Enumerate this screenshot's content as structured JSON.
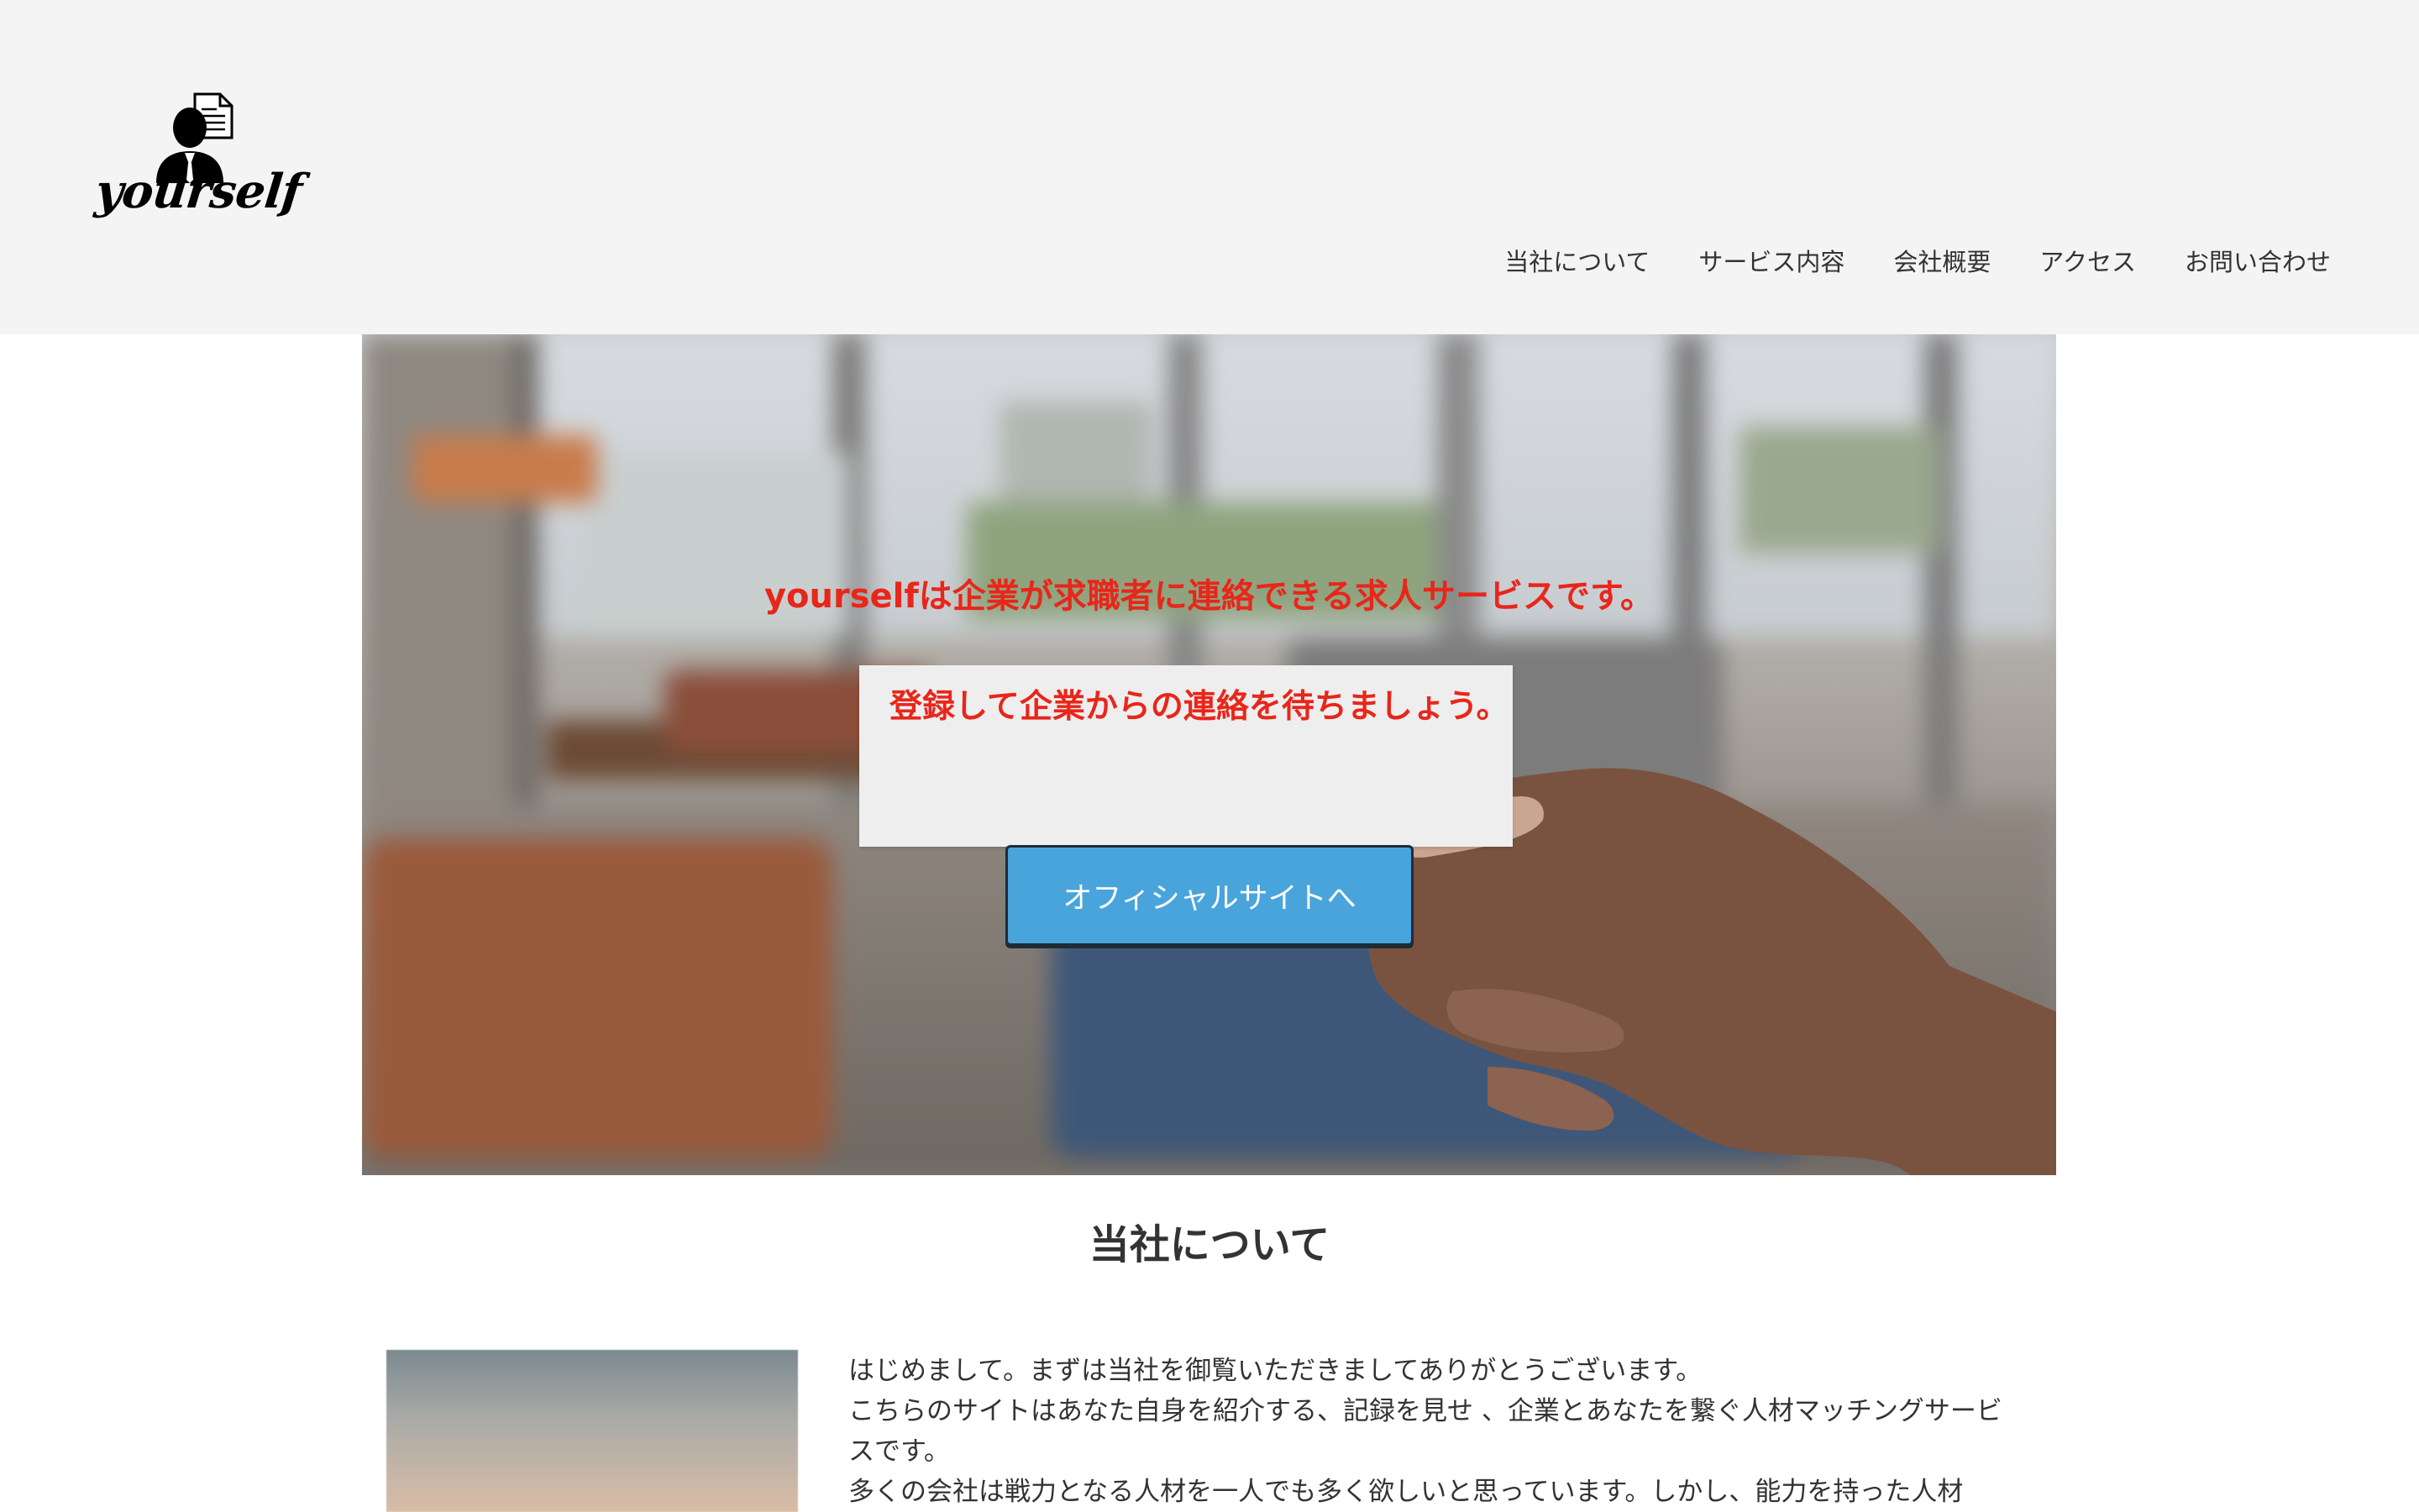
{
  "header": {
    "logo_text": "yourself",
    "nav": [
      {
        "label": "当社について"
      },
      {
        "label": "サービス内容"
      },
      {
        "label": "会社概要"
      },
      {
        "label": "アクセス"
      },
      {
        "label": "お問い合わせ"
      }
    ]
  },
  "hero": {
    "headline": "yourselfは企業が求職者に連絡できる求人サービスです。",
    "card_text": "登録して企業からの連絡を待ちましょう。",
    "cta_label": "オフィシャルサイトへ"
  },
  "about": {
    "title": "当社について",
    "paragraphs": [
      "はじめまして。まずは当社を御覧いただきましてありがとうございます。",
      "こちらのサイトはあなた自身を紹介する、記録を見せ 、企業とあなたを繋ぐ人材マッチングサービスです。",
      "多くの会社は戦力となる人材を一人でも多く欲しいと思っています。しかし、能力を持った人材"
    ]
  },
  "colors": {
    "header_bg": "#f4f4f4",
    "accent_red": "#e8261a",
    "cta_blue": "#4aa4dc"
  }
}
